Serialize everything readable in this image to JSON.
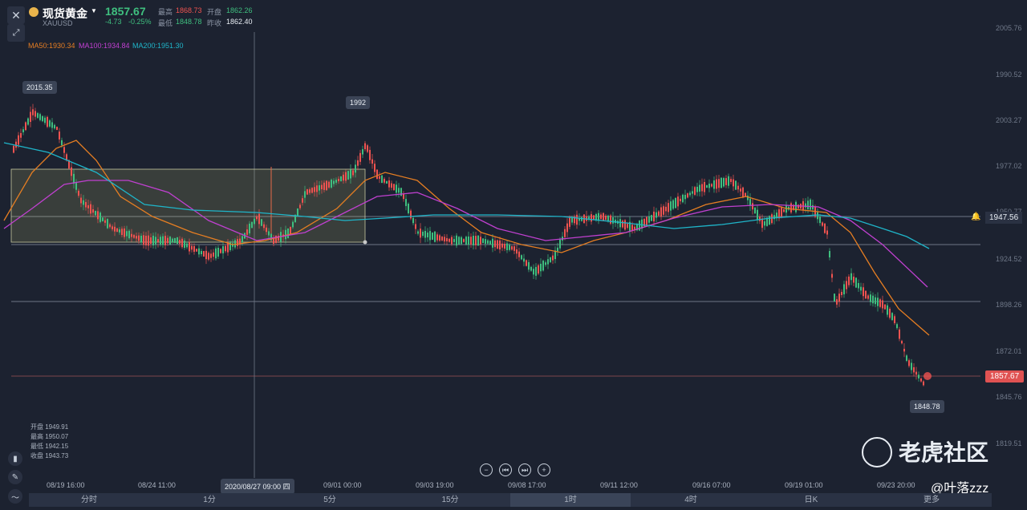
{
  "header": {
    "title": "现货黄金",
    "symbol": "XAUUSD",
    "price": "1857.67",
    "change": "-4.73",
    "change_pct": "-0.25%",
    "high_label": "最高",
    "high": "1868.73",
    "open_label": "开盘",
    "open": "1862.26",
    "low_label": "最低",
    "low": "1848.78",
    "prev_close_label": "昨收",
    "prev_close": "1862.40"
  },
  "ma": {
    "ma50": "MA50:1930.34",
    "ma100": "MA100:1934.84",
    "ma200": "MA200:1951.30"
  },
  "y_axis": [
    "2005.76",
    "1990.52",
    "2003.27",
    "1977.02",
    "1950.77",
    "1924.52",
    "1898.26",
    "1872.01",
    "1845.76",
    "1819.51"
  ],
  "x_axis": [
    "08/19 16:00",
    "08/24 11:00",
    "2020/08/27 09:00 四",
    "09/01 00:00",
    "09/03 19:00",
    "09/08 17:00",
    "09/11 12:00",
    "09/16 07:00",
    "09/19 01:00",
    "09/23 20:00"
  ],
  "annotations": {
    "high_mark": "2015.35",
    "crosshair_bubble": "1992",
    "low_mark": "1848.78",
    "level_alert": "1947.56",
    "current_price_tag": "1857.67"
  },
  "ohlc": {
    "open": "开盘 1949.91",
    "high": "最高 1950.07",
    "low": "最低 1942.15",
    "close": "收盘 1943.73"
  },
  "timeframes": [
    "分时",
    "1分",
    "5分",
    "15分",
    "1时",
    "4时",
    "日K",
    "更多"
  ],
  "active_timeframe": "1时",
  "watermark": {
    "brand": "老虎社区",
    "user": "@叶落zzz"
  },
  "colors": {
    "up": "#3fbf7f",
    "down": "#ef5350",
    "ma50": "#e67e22",
    "ma100": "#c040d0",
    "ma200": "#1fb5c9",
    "bg": "#1c2230"
  }
}
